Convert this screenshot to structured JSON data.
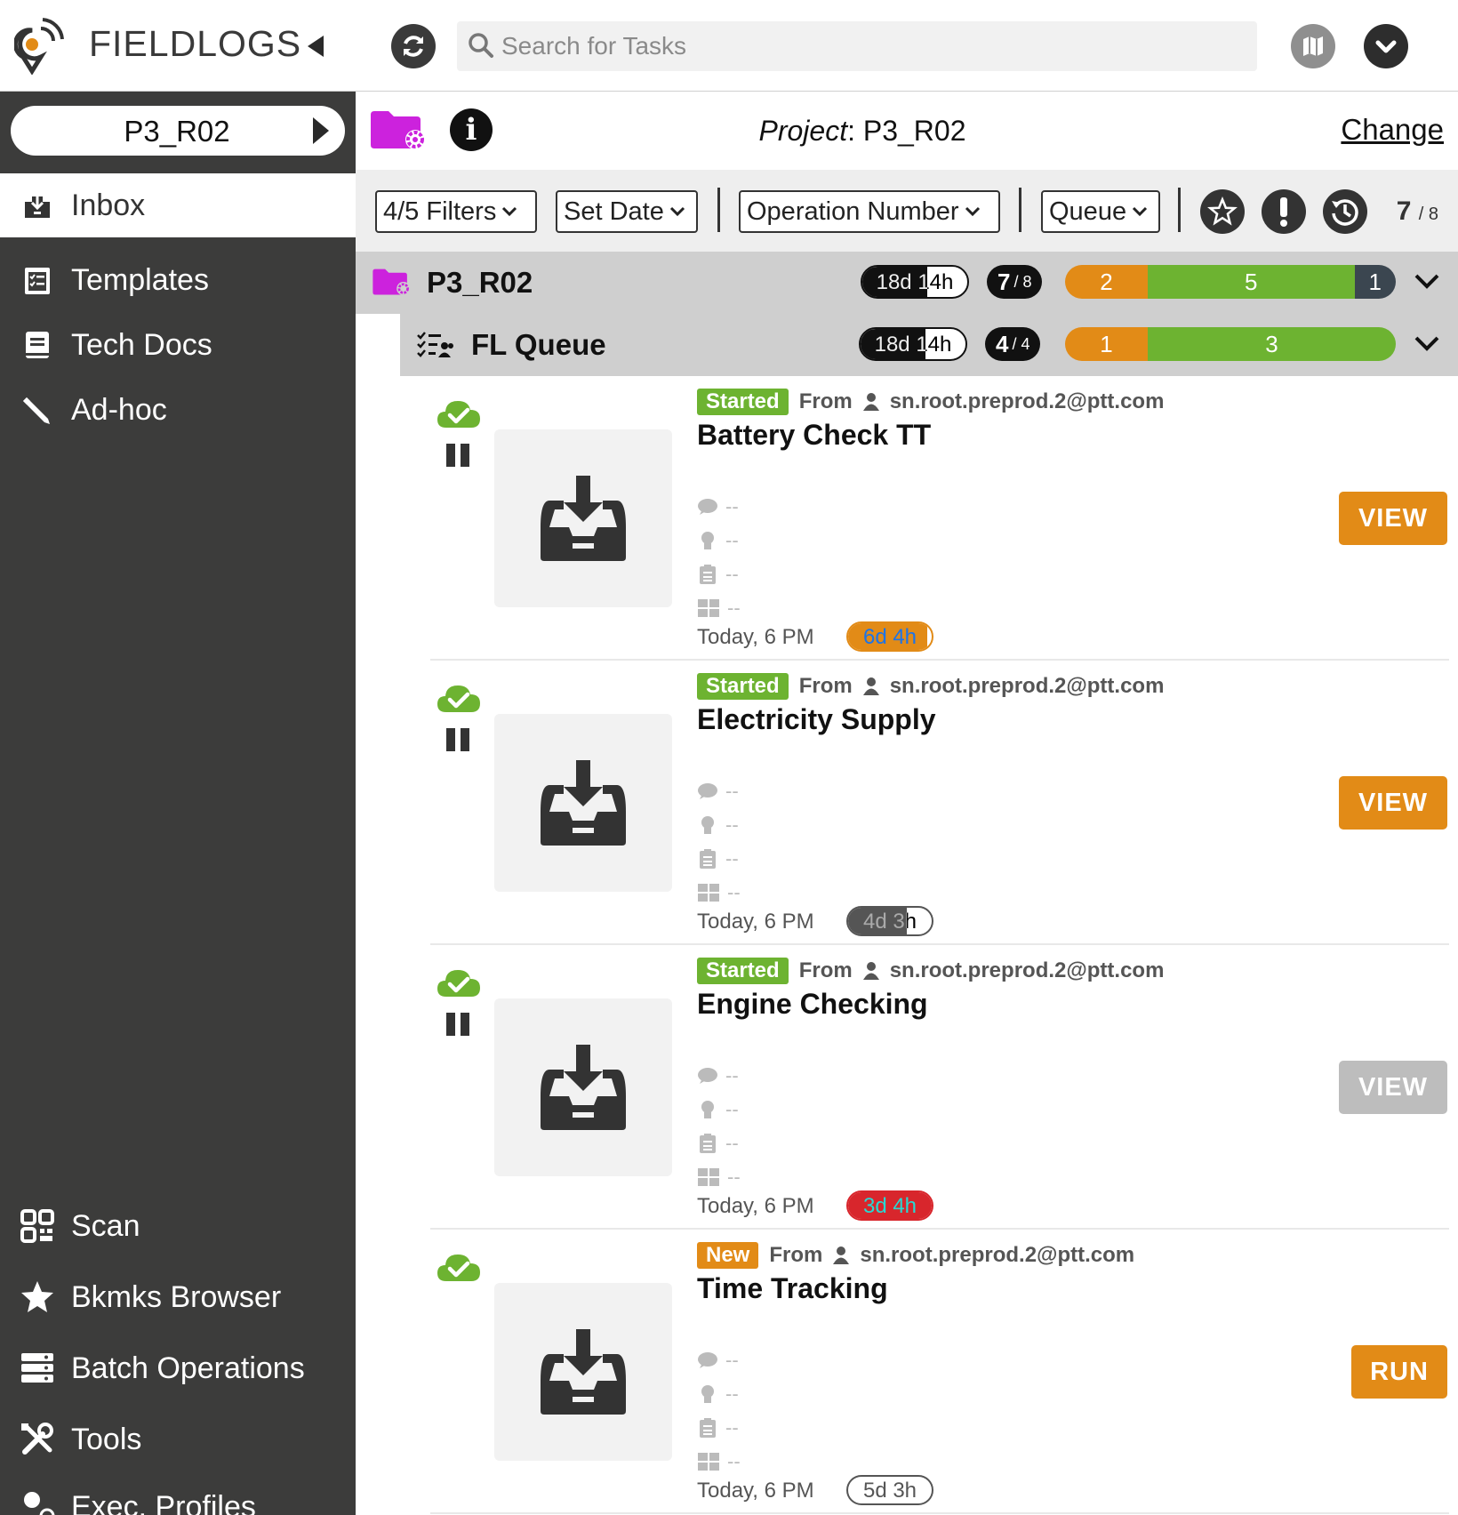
{
  "header": {
    "app_name": "FIELDLOGS",
    "search_placeholder": "Search for Tasks"
  },
  "sidebar": {
    "project_selector": "P3_R02",
    "nav_top": [
      {
        "label": "Inbox",
        "icon": "inbox-icon",
        "active": true
      },
      {
        "label": "Templates",
        "icon": "clipboard-check-icon"
      },
      {
        "label": "Tech Docs",
        "icon": "book-icon"
      },
      {
        "label": "Ad-hoc",
        "icon": "pencil-icon"
      }
    ],
    "nav_bottom": [
      {
        "label": "Scan",
        "icon": "qr-code-icon"
      },
      {
        "label": "Bkmks Browser",
        "icon": "star-icon"
      },
      {
        "label": "Batch Operations",
        "icon": "server-stack-icon"
      },
      {
        "label": "Tools",
        "icon": "tools-icon"
      },
      {
        "label": "Exec. Profiles",
        "icon": "user-gear-icon"
      }
    ]
  },
  "project_bar": {
    "label_prefix": "Project",
    "project_name": ": P3_R02",
    "change_label": "Change"
  },
  "filters": {
    "filters_label": "4/5 Filters",
    "date_label": "Set Date",
    "operation_label": "Operation Number",
    "queue_label": "Queue",
    "count_main": "7",
    "count_total": "/ 8"
  },
  "group": {
    "name": "P3_R02",
    "time": "18d 14h",
    "time_progress": 0.62,
    "count_done": "7",
    "count_total": "/ 8",
    "segments": [
      {
        "value": 2,
        "color": "#e28b17"
      },
      {
        "value": 5,
        "color": "#6db331"
      },
      {
        "value": 1,
        "color": "#3b4650"
      }
    ]
  },
  "queue": {
    "name": "FL Queue",
    "time": "18d 14h",
    "time_progress": 0.62,
    "count_done": "4",
    "count_total": "/ 4",
    "segments": [
      {
        "value": 1,
        "color": "#e28b17"
      },
      {
        "value": 3,
        "color": "#6db331"
      }
    ]
  },
  "colors": {
    "started": "#6db331",
    "new": "#e28b17",
    "orange": "#e28b17",
    "grey_button": "#bdbdbd",
    "red": "#d8262c",
    "dark_grey": "#555555",
    "folder_magenta": "#cc22dd"
  },
  "tasks": [
    {
      "status": "Started",
      "status_color": "#6db331",
      "from_label": "From",
      "user": "sn.root.preprod.2@ptt.com",
      "name": "Battery Check TT",
      "meta": [
        "--",
        "--",
        "--",
        "--"
      ],
      "date": "Today, 6 PM",
      "due": "6d 4h",
      "due_color": "#e28b17",
      "due_progress": 0.95,
      "action": "VIEW",
      "action_color": "#e28b17",
      "paused": true
    },
    {
      "status": "Started",
      "status_color": "#6db331",
      "from_label": "From",
      "user": "sn.root.preprod.2@ptt.com",
      "name": "Electricity Supply",
      "meta": [
        "--",
        "--",
        "--",
        "--"
      ],
      "date": "Today, 6 PM",
      "due": "4d 3h",
      "due_color": "#555555",
      "due_progress": 0.7,
      "action": "VIEW",
      "action_color": "#e28b17",
      "paused": true
    },
    {
      "status": "Started",
      "status_color": "#6db331",
      "from_label": "From",
      "user": "sn.root.preprod.2@ptt.com",
      "name": "Engine  Checking",
      "meta": [
        "--",
        "--",
        "--",
        "--"
      ],
      "date": "Today, 6 PM",
      "due": "3d 4h",
      "due_color": "#d8262c",
      "due_progress": 1.0,
      "action": "VIEW",
      "action_color": "#bdbdbd",
      "paused": true
    },
    {
      "status": "New",
      "status_color": "#e28b17",
      "from_label": "From",
      "user": "sn.root.preprod.2@ptt.com",
      "name": "Time Tracking",
      "meta": [
        "--",
        "--",
        "--",
        "--"
      ],
      "date": "Today, 6 PM",
      "due": "5d 3h",
      "due_color": "#555555",
      "due_progress": 0.0,
      "action": "RUN",
      "action_color": "#e28b17",
      "paused": false
    }
  ]
}
